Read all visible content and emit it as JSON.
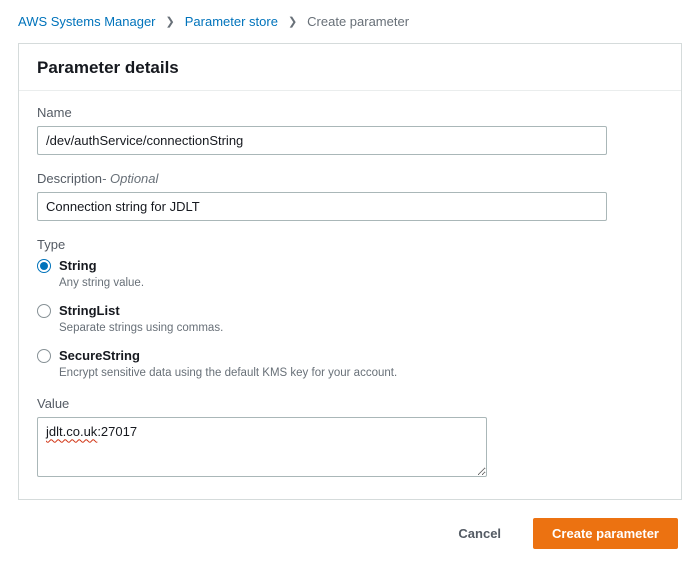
{
  "breadcrumb": {
    "service": "AWS Systems Manager",
    "section": "Parameter store",
    "current": "Create parameter"
  },
  "panel": {
    "title": "Parameter details"
  },
  "fields": {
    "name": {
      "label": "Name",
      "value": "/dev/authService/connectionString"
    },
    "description": {
      "label": "Description",
      "optional_suffix": "- Optional",
      "value": "Connection string for JDLT"
    },
    "type": {
      "label": "Type",
      "options": [
        {
          "label": "String",
          "desc": "Any string value.",
          "selected": true
        },
        {
          "label": "StringList",
          "desc": "Separate strings using commas.",
          "selected": false
        },
        {
          "label": "SecureString",
          "desc": "Encrypt sensitive data using the default KMS key for your account.",
          "selected": false
        }
      ]
    },
    "value": {
      "label": "Value",
      "value": "jdlt.co.uk:27017"
    }
  },
  "footer": {
    "cancel": "Cancel",
    "submit": "Create parameter"
  }
}
